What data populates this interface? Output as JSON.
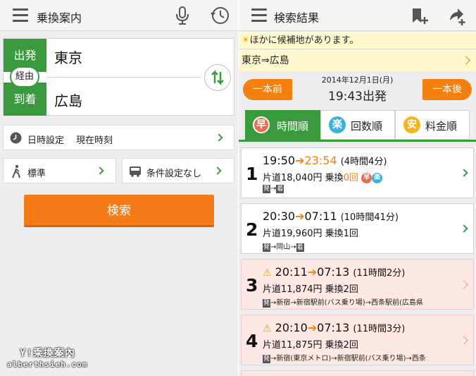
{
  "left": {
    "title": "乗換案内",
    "dep_label": "出発",
    "dep_station": "東京",
    "via_label": "経由",
    "arr_label": "到着",
    "arr_station": "広島",
    "datetime_label": "日時設定",
    "datetime_value": "現在時刻",
    "route_type": "標準",
    "conditions": "条件設定なし",
    "search_button": "検索"
  },
  "right": {
    "title": "検索結果",
    "notice": "ほかに候補地があります。",
    "route_summary": "東京⇒広島",
    "date": "2014年12月1日(月)",
    "time": "19:43出発",
    "prev": "一本前",
    "next": "一本後",
    "tabs": [
      {
        "badge": "早",
        "label": "時間順",
        "color": "#f06a4a"
      },
      {
        "badge": "楽",
        "label": "回数順",
        "color": "#3bb3d8"
      },
      {
        "badge": "安",
        "label": "料金順",
        "color": "#f2b51c"
      }
    ],
    "results": [
      {
        "num": "1",
        "dep": "19:50",
        "arr": "23:54",
        "dur": "(4時間4分)",
        "fare": "片道18,040円",
        "transfer_label": "乗換",
        "transfer_count": "0回",
        "route": "発→着",
        "warn": false
      },
      {
        "num": "2",
        "dep": "20:30",
        "arr": "07:11",
        "dur": "(10時間41分)",
        "fare": "片道19,960円",
        "transfer_label": "乗換",
        "transfer_count": "1回",
        "route": "発→岡山→着",
        "warn": false
      },
      {
        "num": "3",
        "dep": "20:11",
        "arr": "07:13",
        "dur": "(11時間2分)",
        "fare": "片道11,874円",
        "transfer_label": "乗換",
        "transfer_count": "2回",
        "route": "発→新宿→新宿駅前(バス乗り場)→西条駅前(広島県",
        "warn": true
      },
      {
        "num": "4",
        "dep": "20:10",
        "arr": "07:13",
        "dur": "(11時間3分)",
        "fare": "片道11,875円",
        "transfer_label": "乗換",
        "transfer_count": "2回",
        "route": "発→新宿(東京メトロ)→新宿駅前(バス乗り場)→西条",
        "warn": true
      }
    ]
  },
  "watermark": {
    "line1": "Y!乘換案內",
    "line2": "alberthsieh.com"
  }
}
